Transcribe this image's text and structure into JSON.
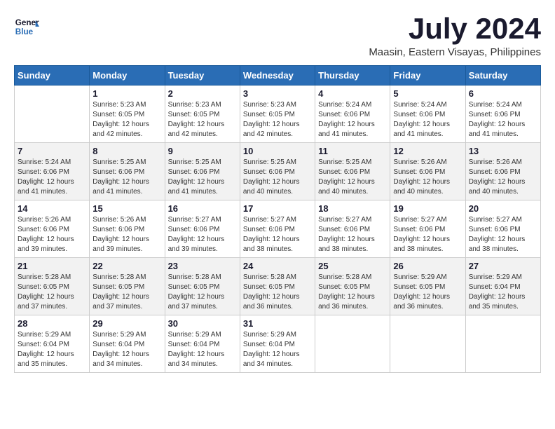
{
  "logo": {
    "line1": "General",
    "line2": "Blue"
  },
  "title": "July 2024",
  "location": "Maasin, Eastern Visayas, Philippines",
  "weekdays": [
    "Sunday",
    "Monday",
    "Tuesday",
    "Wednesday",
    "Thursday",
    "Friday",
    "Saturday"
  ],
  "weeks": [
    [
      {
        "day": "",
        "info": ""
      },
      {
        "day": "1",
        "info": "Sunrise: 5:23 AM\nSunset: 6:05 PM\nDaylight: 12 hours\nand 42 minutes."
      },
      {
        "day": "2",
        "info": "Sunrise: 5:23 AM\nSunset: 6:05 PM\nDaylight: 12 hours\nand 42 minutes."
      },
      {
        "day": "3",
        "info": "Sunrise: 5:23 AM\nSunset: 6:05 PM\nDaylight: 12 hours\nand 42 minutes."
      },
      {
        "day": "4",
        "info": "Sunrise: 5:24 AM\nSunset: 6:06 PM\nDaylight: 12 hours\nand 41 minutes."
      },
      {
        "day": "5",
        "info": "Sunrise: 5:24 AM\nSunset: 6:06 PM\nDaylight: 12 hours\nand 41 minutes."
      },
      {
        "day": "6",
        "info": "Sunrise: 5:24 AM\nSunset: 6:06 PM\nDaylight: 12 hours\nand 41 minutes."
      }
    ],
    [
      {
        "day": "7",
        "info": "Sunrise: 5:24 AM\nSunset: 6:06 PM\nDaylight: 12 hours\nand 41 minutes."
      },
      {
        "day": "8",
        "info": "Sunrise: 5:25 AM\nSunset: 6:06 PM\nDaylight: 12 hours\nand 41 minutes."
      },
      {
        "day": "9",
        "info": "Sunrise: 5:25 AM\nSunset: 6:06 PM\nDaylight: 12 hours\nand 41 minutes."
      },
      {
        "day": "10",
        "info": "Sunrise: 5:25 AM\nSunset: 6:06 PM\nDaylight: 12 hours\nand 40 minutes."
      },
      {
        "day": "11",
        "info": "Sunrise: 5:25 AM\nSunset: 6:06 PM\nDaylight: 12 hours\nand 40 minutes."
      },
      {
        "day": "12",
        "info": "Sunrise: 5:26 AM\nSunset: 6:06 PM\nDaylight: 12 hours\nand 40 minutes."
      },
      {
        "day": "13",
        "info": "Sunrise: 5:26 AM\nSunset: 6:06 PM\nDaylight: 12 hours\nand 40 minutes."
      }
    ],
    [
      {
        "day": "14",
        "info": "Sunrise: 5:26 AM\nSunset: 6:06 PM\nDaylight: 12 hours\nand 39 minutes."
      },
      {
        "day": "15",
        "info": "Sunrise: 5:26 AM\nSunset: 6:06 PM\nDaylight: 12 hours\nand 39 minutes."
      },
      {
        "day": "16",
        "info": "Sunrise: 5:27 AM\nSunset: 6:06 PM\nDaylight: 12 hours\nand 39 minutes."
      },
      {
        "day": "17",
        "info": "Sunrise: 5:27 AM\nSunset: 6:06 PM\nDaylight: 12 hours\nand 38 minutes."
      },
      {
        "day": "18",
        "info": "Sunrise: 5:27 AM\nSunset: 6:06 PM\nDaylight: 12 hours\nand 38 minutes."
      },
      {
        "day": "19",
        "info": "Sunrise: 5:27 AM\nSunset: 6:06 PM\nDaylight: 12 hours\nand 38 minutes."
      },
      {
        "day": "20",
        "info": "Sunrise: 5:27 AM\nSunset: 6:06 PM\nDaylight: 12 hours\nand 38 minutes."
      }
    ],
    [
      {
        "day": "21",
        "info": "Sunrise: 5:28 AM\nSunset: 6:05 PM\nDaylight: 12 hours\nand 37 minutes."
      },
      {
        "day": "22",
        "info": "Sunrise: 5:28 AM\nSunset: 6:05 PM\nDaylight: 12 hours\nand 37 minutes."
      },
      {
        "day": "23",
        "info": "Sunrise: 5:28 AM\nSunset: 6:05 PM\nDaylight: 12 hours\nand 37 minutes."
      },
      {
        "day": "24",
        "info": "Sunrise: 5:28 AM\nSunset: 6:05 PM\nDaylight: 12 hours\nand 36 minutes."
      },
      {
        "day": "25",
        "info": "Sunrise: 5:28 AM\nSunset: 6:05 PM\nDaylight: 12 hours\nand 36 minutes."
      },
      {
        "day": "26",
        "info": "Sunrise: 5:29 AM\nSunset: 6:05 PM\nDaylight: 12 hours\nand 36 minutes."
      },
      {
        "day": "27",
        "info": "Sunrise: 5:29 AM\nSunset: 6:04 PM\nDaylight: 12 hours\nand 35 minutes."
      }
    ],
    [
      {
        "day": "28",
        "info": "Sunrise: 5:29 AM\nSunset: 6:04 PM\nDaylight: 12 hours\nand 35 minutes."
      },
      {
        "day": "29",
        "info": "Sunrise: 5:29 AM\nSunset: 6:04 PM\nDaylight: 12 hours\nand 34 minutes."
      },
      {
        "day": "30",
        "info": "Sunrise: 5:29 AM\nSunset: 6:04 PM\nDaylight: 12 hours\nand 34 minutes."
      },
      {
        "day": "31",
        "info": "Sunrise: 5:29 AM\nSunset: 6:04 PM\nDaylight: 12 hours\nand 34 minutes."
      },
      {
        "day": "",
        "info": ""
      },
      {
        "day": "",
        "info": ""
      },
      {
        "day": "",
        "info": ""
      }
    ]
  ]
}
